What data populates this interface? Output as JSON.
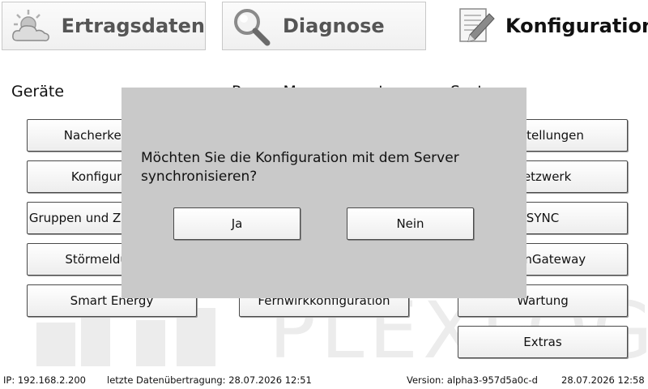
{
  "tabs": [
    {
      "label": "Ertragsdaten",
      "icon": "sun-cloud-icon"
    },
    {
      "label": "Diagnose",
      "icon": "magnifier-icon"
    },
    {
      "label": "Konfiguration",
      "icon": "document-pencil-icon",
      "active": true
    }
  ],
  "sections": {
    "geraete": "Geräte",
    "power_management": "Power Management",
    "system": "System"
  },
  "watermark": {
    "text": "PLEXLOG"
  },
  "buttons": {
    "col1": [
      "Nacherkennung",
      "Konfiguration",
      "Gruppen und Zuordnungen",
      "Störmeldungen",
      "Smart Energy"
    ],
    "col2": [
      "Fernwirkkonfiguration"
    ],
    "col3": [
      "Einstellungen",
      "Netzwerk",
      "SYNC",
      "OpenGateway",
      "Wartung",
      "Extras"
    ]
  },
  "dialog": {
    "message": "Möchten Sie die Konfiguration mit dem Server synchronisieren?",
    "yes": "Ja",
    "no": "Nein"
  },
  "status": {
    "ip": "IP: 192.168.2.200",
    "last_transfer": "letzte Datenübertragung: 28.07.2026 12:51",
    "version": "Version: alpha3-957d5a0c-d",
    "datetime": "28.07.2026 12:58"
  },
  "colors": {
    "dialog_bg": "#c9c9c9",
    "watermark": "#ececec"
  }
}
